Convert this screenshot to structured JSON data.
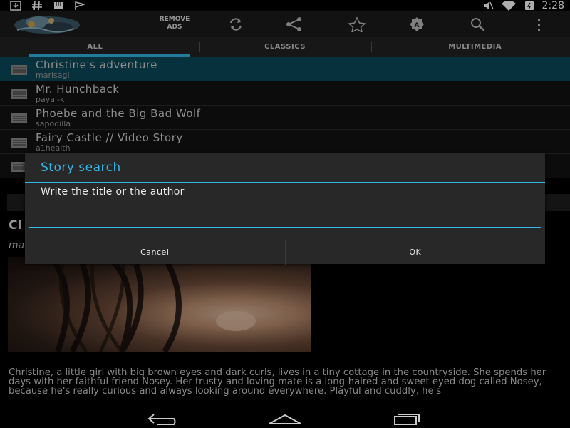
{
  "status_bar": {
    "time": "2:28",
    "left_icons": [
      "download-icon",
      "hash-icon",
      "sd-card-icon",
      "flag-icon"
    ],
    "right_icons": [
      "muted-icon",
      "wifi-icon",
      "battery-icon"
    ]
  },
  "action_bar": {
    "remove_ads_line1": "REMOVE",
    "remove_ads_line2": "ADS",
    "icons": [
      "refresh-icon",
      "share-icon",
      "star-icon",
      "font-icon",
      "search-icon",
      "overflow-menu-icon"
    ]
  },
  "tabs": [
    {
      "label": "ALL",
      "active": true
    },
    {
      "label": "CLASSICS",
      "active": false
    },
    {
      "label": "MULTIMEDIA",
      "active": false
    }
  ],
  "stories": [
    {
      "title": "Christine's adventure",
      "author": "marisagi",
      "selected": true
    },
    {
      "title": "Mr. Hunchback",
      "author": "payal-k",
      "selected": false
    },
    {
      "title": "Phoebe and the Big Bad Wolf",
      "author": "sapodilla",
      "selected": false
    },
    {
      "title": "Fairy Castle // Video Story",
      "author": "a1health",
      "selected": false
    },
    {
      "title": "",
      "author": "",
      "selected": false
    }
  ],
  "detail": {
    "title_partial": "Cl",
    "author_partial": "ma",
    "text": "Christine, a little girl with big brown eyes and dark curls, lives in a tiny cottage in the countryside. She spends her days with her faithful friend Nosey. Her trusty and loving mate is a long-haired and sweet eyed dog called Nosey, because he's really curious and always looking around everywhere. Playful and cuddly, he's"
  },
  "dialog": {
    "title": "Story search",
    "message": "Write the title or the author",
    "input_value": "",
    "input_placeholder": "",
    "cancel_label": "Cancel",
    "ok_label": "OK"
  },
  "colors": {
    "accent": "#33b5e5",
    "selected_row": "#0b4a5b",
    "dialog_bg": "#282828"
  },
  "nav_bar": {
    "icons": [
      "back-icon",
      "home-icon",
      "recent-apps-icon"
    ]
  }
}
